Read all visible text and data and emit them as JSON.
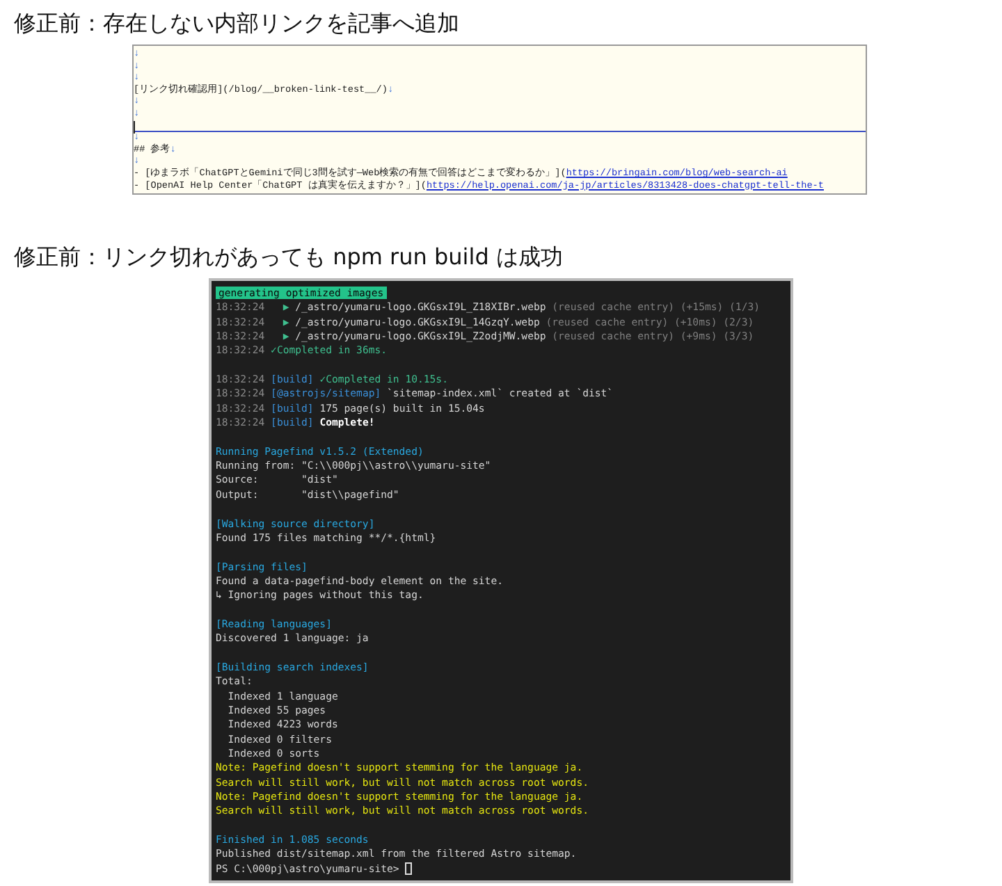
{
  "sections": [
    {
      "title": "修正前：存在しない内部リンクを記事へ追加",
      "kind": "editor",
      "lines": [
        {
          "segments": [
            {
              "text": "↓",
              "kind": "eol"
            }
          ]
        },
        {
          "segments": [
            {
              "text": "↓",
              "kind": "eol"
            }
          ]
        },
        {
          "segments": [
            {
              "text": "↓",
              "kind": "eol"
            }
          ]
        },
        {
          "segments": [
            {
              "text": "[リンク切れ確認用](/blog/__broken-link-test__/)",
              "kind": "plain"
            },
            {
              "text": "↓",
              "kind": "eol"
            }
          ]
        },
        {
          "segments": [
            {
              "text": "↓",
              "kind": "eol"
            }
          ]
        },
        {
          "segments": [
            {
              "text": "↓",
              "kind": "eol"
            }
          ]
        },
        {
          "current": true
        },
        {
          "segments": [
            {
              "text": "↓",
              "kind": "eol"
            }
          ]
        },
        {
          "segments": [
            {
              "text": "## 参考",
              "kind": "plain"
            },
            {
              "text": "↓",
              "kind": "eol"
            }
          ]
        },
        {
          "segments": [
            {
              "text": "↓",
              "kind": "eol"
            }
          ]
        },
        {
          "segments": [
            {
              "text": "- [ゆまラボ「ChatGPTとGeminiで同じ3問を試す—Web検索の有無で回答はどこまで変わるか」](",
              "kind": "plain"
            },
            {
              "text": "https://bringain.com/blog/web-search-ai",
              "kind": "link"
            }
          ]
        },
        {
          "segments": [
            {
              "text": "- [OpenAI Help Center「ChatGPT は真実を伝えますか？」](",
              "kind": "plain"
            },
            {
              "text": "https://help.openai.com/ja-jp/articles/8313428-does-chatgpt-tell-the-t",
              "kind": "link"
            }
          ]
        }
      ]
    },
    {
      "title": "修正前：リンク切れがあっても npm run build は成功",
      "kind": "terminal",
      "cursor": true,
      "blocks": [
        [
          [
            {
              "text": "generating optimized images",
              "kind": "badge"
            }
          ],
          [
            {
              "text": "18:32:24",
              "kind": "time"
            },
            {
              "text": "   ▶ ",
              "kind": "green"
            },
            {
              "text": "/_astro/yumaru-logo.GKGsxI9L_Z18XIBr.webp ",
              "kind": "white"
            },
            {
              "text": "(reused cache entry) (+15ms) (1/3)",
              "kind": "dim"
            }
          ],
          [
            {
              "text": "18:32:24",
              "kind": "time"
            },
            {
              "text": "   ▶ ",
              "kind": "green"
            },
            {
              "text": "/_astro/yumaru-logo.GKGsxI9L_14GzqY.webp ",
              "kind": "white"
            },
            {
              "text": "(reused cache entry) (+10ms) (2/3)",
              "kind": "dim"
            }
          ],
          [
            {
              "text": "18:32:24",
              "kind": "time"
            },
            {
              "text": "   ▶ ",
              "kind": "green"
            },
            {
              "text": "/_astro/yumaru-logo.GKGsxI9L_Z2odjMW.webp ",
              "kind": "white"
            },
            {
              "text": "(reused cache entry) (+9ms) (3/3)",
              "kind": "dim"
            }
          ],
          [
            {
              "text": "18:32:24",
              "kind": "time"
            },
            {
              "text": " ✓Completed in 36ms.",
              "kind": "green"
            }
          ]
        ],
        [
          [
            {
              "text": "18:32:24",
              "kind": "time"
            },
            {
              "text": " [build]",
              "kind": "blue"
            },
            {
              "text": " ✓Completed in 10.15s.",
              "kind": "green"
            }
          ],
          [
            {
              "text": "18:32:24",
              "kind": "time"
            },
            {
              "text": " [@astrojs/sitemap]",
              "kind": "blue"
            },
            {
              "text": " `sitemap-index.xml` created at `dist`",
              "kind": "white"
            }
          ],
          [
            {
              "text": "18:32:24",
              "kind": "time"
            },
            {
              "text": " [build]",
              "kind": "blue"
            },
            {
              "text": " 175 page(s) built in 15.04s",
              "kind": "white"
            }
          ],
          [
            {
              "text": "18:32:24",
              "kind": "time"
            },
            {
              "text": " [build]",
              "kind": "blue"
            },
            {
              "text": " Complete!",
              "kind": "bold"
            }
          ]
        ],
        [
          [
            {
              "text": "Running Pagefind v1.5.2 (Extended)",
              "kind": "cyan"
            }
          ],
          [
            {
              "text": "Running from: \"C:\\\\000pj\\\\astro\\\\yumaru-site\"",
              "kind": "white"
            }
          ],
          [
            {
              "text": "Source:       \"dist\"",
              "kind": "white"
            }
          ],
          [
            {
              "text": "Output:       \"dist\\\\pagefind\"",
              "kind": "white"
            }
          ]
        ],
        [
          [
            {
              "text": "[Walking source directory]",
              "kind": "cyan"
            }
          ],
          [
            {
              "text": "Found 175 files matching **/*.{html}",
              "kind": "white"
            }
          ]
        ],
        [
          [
            {
              "text": "[Parsing files]",
              "kind": "cyan"
            }
          ],
          [
            {
              "text": "Found a data-pagefind-body element on the site.",
              "kind": "white"
            }
          ],
          [
            {
              "text": "↳ Ignoring pages without this tag.",
              "kind": "white"
            }
          ]
        ],
        [
          [
            {
              "text": "[Reading languages]",
              "kind": "cyan"
            }
          ],
          [
            {
              "text": "Discovered 1 language: ja",
              "kind": "white"
            }
          ]
        ],
        [
          [
            {
              "text": "[Building search indexes]",
              "kind": "cyan"
            }
          ],
          [
            {
              "text": "Total:",
              "kind": "white"
            }
          ],
          [
            {
              "text": "  Indexed 1 language",
              "kind": "white"
            }
          ],
          [
            {
              "text": "  Indexed 55 pages",
              "kind": "white"
            }
          ],
          [
            {
              "text": "  Indexed 4223 words",
              "kind": "white"
            }
          ],
          [
            {
              "text": "  Indexed 0 filters",
              "kind": "white"
            }
          ],
          [
            {
              "text": "  Indexed 0 sorts",
              "kind": "white"
            }
          ],
          [
            {
              "text": "Note: Pagefind doesn't support stemming for the language ja.",
              "kind": "yellow"
            }
          ],
          [
            {
              "text": "Search will still work, but will not match across root words.",
              "kind": "yellow"
            }
          ],
          [
            {
              "text": "Note: Pagefind doesn't support stemming for the language ja.",
              "kind": "yellow"
            }
          ],
          [
            {
              "text": "Search will still work, but will not match across root words.",
              "kind": "yellow"
            }
          ]
        ],
        [
          [
            {
              "text": "Finished in 1.085 seconds",
              "kind": "cyan"
            }
          ],
          [
            {
              "text": "Published dist/sitemap.xml from the filtered Astro sitemap.",
              "kind": "white"
            }
          ],
          [
            {
              "text": "PS C:\\000pj\\astro\\yumaru-site> ",
              "kind": "white"
            }
          ]
        ]
      ]
    }
  ]
}
